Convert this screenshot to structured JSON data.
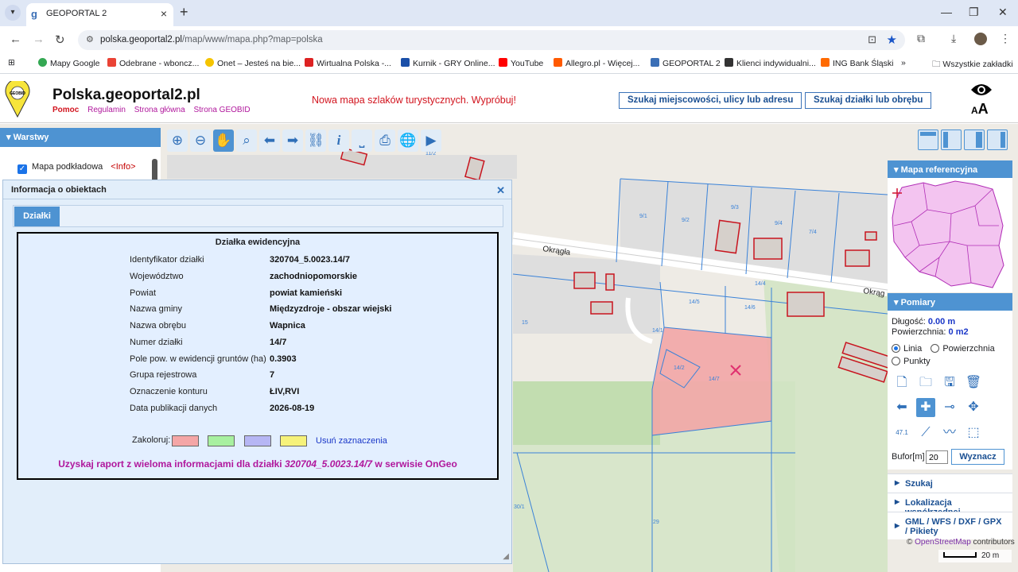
{
  "browser": {
    "tab_title": "GEOPORTAL 2",
    "url_host": "polska.geoportal2.pl",
    "url_path": "/map/www/mapa.php?map=polska",
    "bookmarks": [
      "Mapy Google",
      "Odebrane - wboncz...",
      "Onet – Jesteś na bie...",
      "Wirtualna Polska -...",
      "Kurnik - GRY Online...",
      "YouTube",
      "Allegro.pl - Więcej...",
      "GEOPORTAL 2",
      "Klienci indywidualni...",
      "ING Bank Śląski"
    ],
    "bookmarks_more": "»",
    "all_bookmarks": "Wszystkie zakładki"
  },
  "header": {
    "logo_text": "GEOBID",
    "title": "Polska.geoportal2.pl",
    "links": [
      "Pomoc",
      "Regulamin",
      "Strona główna",
      "Strona GEOBID"
    ],
    "promo": "Nowa mapa szlaków turystycznych. Wypróbuj!",
    "search_address_button": "Szukaj miejscowości, ulicy lub adresu",
    "search_parcel_button": "Szukaj działki lub obrębu",
    "font_size_label": "A",
    "font_size_label_big": "A",
    "colors": {
      "red": "#d2141e",
      "magenta": "#b0179c",
      "accent": "#4e93d2"
    }
  },
  "layers": {
    "header": "Warstwy",
    "item_label": "Mapa podkładowa",
    "item_info": "<Info>"
  },
  "map": {
    "street_names": [
      "Okrągła",
      "Okrąg"
    ],
    "parcel_labels": [
      "9/1",
      "9/2",
      "9/3",
      "9/4",
      "7/4",
      "14/4",
      "14/5",
      "14/6",
      "14/1",
      "14/2",
      "14/7",
      "15",
      "29",
      "30/1",
      "11/2"
    ],
    "attribution_prefix": "©",
    "attribution_osm": "OpenStreetMap",
    "attribution_suffix": "contributors",
    "scale": "20 m"
  },
  "dialog": {
    "title": "Informacja o obiektach",
    "tab": "Działki",
    "section_title": "Działka ewidencyjna",
    "rows": [
      {
        "key": "Identyfikator działki",
        "value": "320704_5.0023.14/7"
      },
      {
        "key": "Województwo",
        "value": "zachodniopomorskie"
      },
      {
        "key": "Powiat",
        "value": "powiat kamieński"
      },
      {
        "key": "Nazwa gminy",
        "value": "Międzyzdroje - obszar wiejski"
      },
      {
        "key": "Nazwa obrębu",
        "value": "Wapnica"
      },
      {
        "key": "Numer działki",
        "value": "14/7"
      },
      {
        "key": "Pole pow. w ewidencji gruntów (ha)",
        "value": "0.3903"
      },
      {
        "key": "Grupa rejestrowa",
        "value": "7"
      },
      {
        "key": "Oznaczenie konturu",
        "value": "ŁIV,RVI"
      },
      {
        "key": "Data publikacji danych",
        "value": "2026-08-19"
      }
    ],
    "color_label": "Zakoloruj:",
    "swatch_colors": [
      "#f4a6a6",
      "#a8f0a0",
      "#b6b6f4",
      "#f6f27a"
    ],
    "clear_label": "Usuń zaznaczenia",
    "report_prefix": "Uzyskaj raport z wieloma informacjami dla działki",
    "report_parcel": "320704_5.0023.14/7",
    "report_suffix": "w serwisie OnGeo"
  },
  "right_panel": {
    "refmap_header": "Mapa referencyjna",
    "measure_header": "Pomiary",
    "length_label": "Długość:",
    "length_value": "0.00 m",
    "area_label": "Powierzchnia:",
    "area_value": "0 m2",
    "mode_line": "Linia",
    "mode_area": "Powierzchnia",
    "mode_points": "Punkty",
    "coord_tool_label": "47.1",
    "buffer_label": "Bufor[m]",
    "buffer_value": "20",
    "compute_button": "Wyznacz",
    "collapsed": [
      "Szukaj",
      "Lokalizacja współrzędnej",
      "GML / WFS / DXF / GPX / Pikiety"
    ]
  }
}
